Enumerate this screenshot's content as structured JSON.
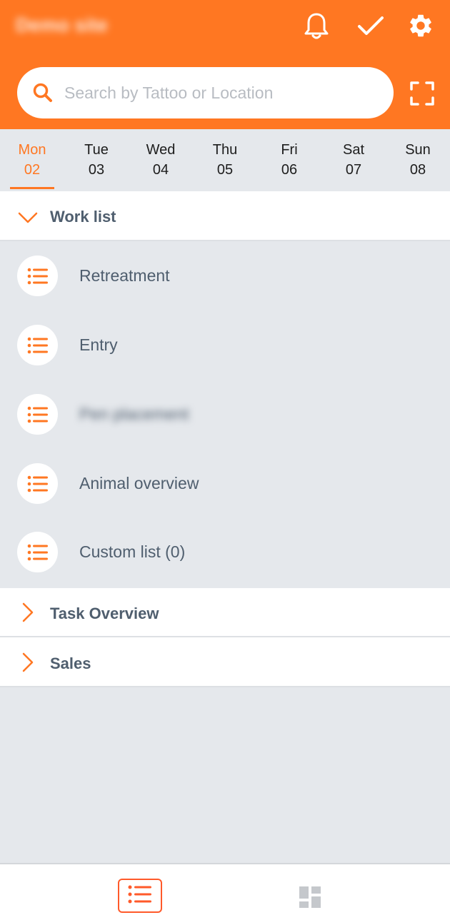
{
  "header": {
    "site_title": "Demo site",
    "accent_color": "#ff7722",
    "icons": [
      "bell-icon",
      "check-icon",
      "gear-icon"
    ]
  },
  "search": {
    "placeholder": "Search by Tattoo or Location",
    "value": "",
    "scan_icon": "scan-icon"
  },
  "days": [
    {
      "name": "Mon",
      "num": "02",
      "active": true
    },
    {
      "name": "Tue",
      "num": "03",
      "active": false
    },
    {
      "name": "Wed",
      "num": "04",
      "active": false
    },
    {
      "name": "Thu",
      "num": "05",
      "active": false
    },
    {
      "name": "Fri",
      "num": "06",
      "active": false
    },
    {
      "name": "Sat",
      "num": "07",
      "active": false
    },
    {
      "name": "Sun",
      "num": "08",
      "active": false
    }
  ],
  "worklist": {
    "title": "Work list",
    "expanded": true,
    "items": [
      {
        "label": "Retreatment",
        "icon": "list-icon"
      },
      {
        "label": "Entry",
        "icon": "list-icon"
      },
      {
        "label": "Pen placement",
        "icon": "list-icon",
        "blurred": true
      },
      {
        "label": "Animal overview",
        "icon": "list-icon"
      },
      {
        "label": "Custom list (0)",
        "icon": "list-icon"
      }
    ]
  },
  "sections": {
    "task_overview": {
      "title": "Task Overview",
      "expanded": false
    },
    "sales": {
      "title": "Sales",
      "expanded": false
    }
  },
  "bottom_nav": {
    "items": [
      {
        "icon": "list-icon",
        "active": true,
        "active_color": "#ff5a2a"
      },
      {
        "icon": "dashboard-icon",
        "active": false
      }
    ]
  }
}
